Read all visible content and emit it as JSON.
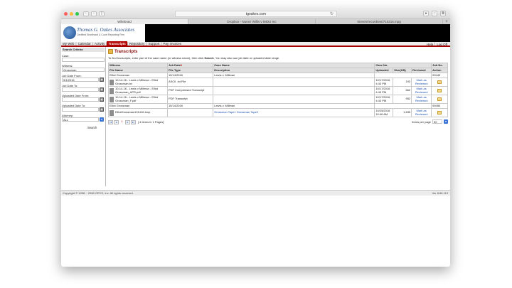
{
  "browser": {
    "address": "tgoakes.com",
    "tabs": [
      "Willebraid",
      "Dropbox - Nunez Willis v IMDU Inc",
      "Steven/recordtest/710216.mpg"
    ]
  },
  "logo": {
    "name": "Thomas G. Oakes Associates",
    "tagline": "Certified Shorthand & Court Reporting Firm"
  },
  "menu": {
    "items": [
      "My Web",
      "Calendar",
      "Activity",
      "Transcripts",
      "Repository",
      "Support",
      "Pay Invoices"
    ],
    "right": [
      "Help",
      "Log Off"
    ]
  },
  "sidebar": {
    "heading": "Search Criteria",
    "case_label": "Case:",
    "case_value": "",
    "witness_label": "Witness:",
    "witness_value": "Grossman",
    "job_from_label": "Job Date From:",
    "job_from_value": "9/1/2016",
    "job_to_label": "Job Date To:",
    "job_to_value": "",
    "up_from_label": "Uploaded Date From:",
    "up_from_value": "",
    "up_to_label": "Uploaded Date To:",
    "up_to_value": "",
    "attorney_label": "Attorney:",
    "attorney_value": "ALL",
    "search_label": "Search"
  },
  "main": {
    "title": "Transcripts",
    "instructions_pre": "To find transcripts, enter part of the case name (or witness name), then click ",
    "instructions_bold": "Search",
    "instructions_post": ". You may also use job date or uploaded date range.",
    "headers_top": [
      "Witness",
      "Job Date",
      "Case Name",
      "Case No.",
      "Job No."
    ],
    "headers_sub": [
      "File Name",
      "File Type",
      "Description",
      "Uploaded",
      "Size(KB)",
      "Reviewed",
      "Action"
    ],
    "groups": [
      {
        "witness": "Elliot Grossman",
        "job_date": "10/14/2016",
        "case_name": "Lewis v. Millman",
        "case_no": "",
        "job_no": "99449",
        "files": [
          {
            "name": "10-14-16 - Lewis v Millman - Elliot Grossman.txt",
            "type": "ASCII .txt File",
            "desc": "",
            "uploaded": "10/17/2016 4:43 PM",
            "size": "193",
            "reviewed": "Mark as Reviewed"
          },
          {
            "name": "10-14-16 - Lewis v Millman - Elliot Grossman_APR.pdf",
            "type": "PDF Compressed Transcript",
            "desc": "",
            "uploaded": "10/17/2016 4:43 PM",
            "size": "662",
            "reviewed": "Mark as Reviewed"
          },
          {
            "name": "10-14-16 - Lewis v Millman - Elliot Grossman_F.pdf",
            "type": "PDF Transcript",
            "desc": "",
            "uploaded": "10/17/2016 4:43 PM",
            "size": "952",
            "reviewed": "Mark as Reviewed"
          }
        ]
      },
      {
        "witness": "Elliot Grossman",
        "job_date": "10/14/2016",
        "case_name": "Lewis v. Millman",
        "case_no": "",
        "job_no": "99450",
        "files": [
          {
            "name": "ElliotGrossman101416.bmp",
            "type": "",
            "desc": "Grossman Tape1 Grossman Tape2",
            "uploaded": "10/25/2016 10:46 AM",
            "size": "1,635",
            "reviewed": "Mark as Reviewed"
          }
        ]
      }
    ],
    "pager": {
      "page": "1",
      "info": "[ 4 items in 1 Pages]",
      "items_per_page_label": "Items per page",
      "items_per_page": "50"
    }
  },
  "footer": {
    "copyright": "Copyright © 1998 ~ 2008 OPCS, Inc. All rights reserved.",
    "version": "Ver 8.86.113"
  },
  "colors": {
    "accent": "#b30000",
    "link": "#1a4fb0"
  }
}
